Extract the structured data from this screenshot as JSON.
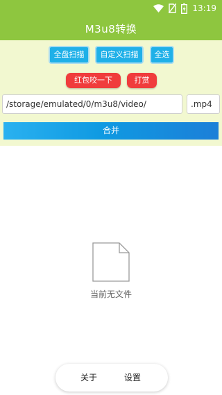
{
  "status_bar": {
    "time": "13:19",
    "icons": [
      "wifi-icon",
      "no-sim-icon",
      "battery-charging-icon"
    ]
  },
  "header": {
    "title": "M3u8转换"
  },
  "toolbar": {
    "full_scan_label": "全盘扫描",
    "custom_scan_label": "自定义扫描",
    "select_all_label": "全选",
    "red_packet_label": "红包咬一下",
    "reward_label": "打赏"
  },
  "path_input": {
    "value": "/storage/emulated/0/m3u8/video/"
  },
  "extension_input": {
    "value": ".mp4"
  },
  "merge_button": {
    "label": "合并"
  },
  "empty_state": {
    "icon": "file-icon",
    "text": "当前无文件"
  },
  "bottom_nav": {
    "about_label": "关于",
    "settings_label": "设置"
  },
  "colors": {
    "header_green": "#8ec63f",
    "panel_bg": "#f2f8d0",
    "button_blue": "#1fb0e8",
    "button_red": "#f03c3c"
  }
}
